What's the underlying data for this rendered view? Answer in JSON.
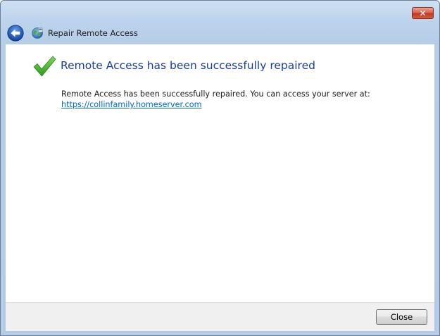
{
  "window": {
    "title": "Repair Remote Access",
    "close_glyph": "✕"
  },
  "content": {
    "heading": "Remote Access has been successfully repaired",
    "message": "Remote Access has been successfully repaired. You can access your server at:",
    "server_link": "https://collinfamily.homeserver.com",
    "status_icon": "checkmark-icon"
  },
  "footer": {
    "close_label": "Close"
  },
  "icons": {
    "back": "back-arrow-icon",
    "app": "globe-icon",
    "window_close": "close-icon"
  },
  "colors": {
    "heading": "#1a3e9c",
    "link": "#0066cc",
    "checkmark": "#3aa626"
  }
}
